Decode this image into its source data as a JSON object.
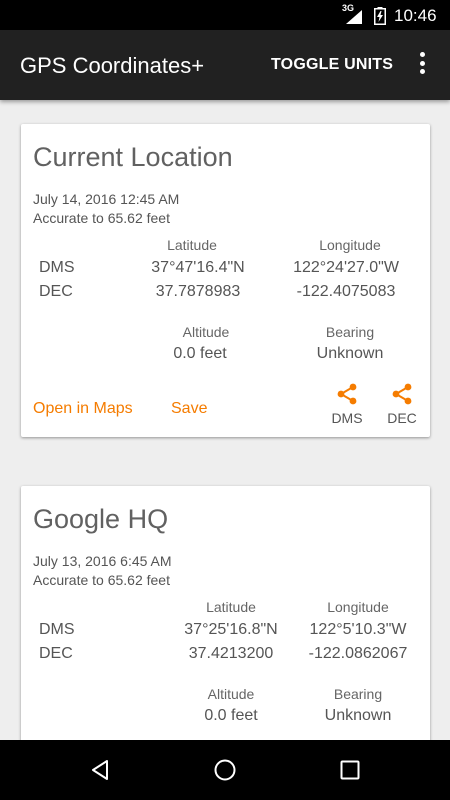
{
  "status_bar": {
    "network": "3G",
    "time": "10:46"
  },
  "app_bar": {
    "title": "GPS Coordinates+",
    "toggle_units": "TOGGLE UNITS",
    "overflow_icon": "more-vert-icon"
  },
  "cards": [
    {
      "title": "Current Location",
      "date": "July 14, 2016 12:45 AM",
      "accuracy": "Accurate to 65.62 feet",
      "latitude_header": "Latitude",
      "longitude_header": "Longitude",
      "dms_label": "DMS",
      "dec_label": "DEC",
      "dms_latitude": "37°47'16.4\"N",
      "dms_longitude": "122°24'27.0\"W",
      "dec_latitude": "37.7878983",
      "dec_longitude": "-122.4075083",
      "altitude_header": "Altitude",
      "altitude": "0.0 feet",
      "bearing_header": "Bearing",
      "bearing": "Unknown",
      "open_in_maps": "Open in Maps",
      "save": "Save",
      "share_dms": "DMS",
      "share_dec": "DEC"
    },
    {
      "title": "Google HQ",
      "date": "July 13, 2016 6:45 AM",
      "accuracy": "Accurate to 65.62 feet",
      "latitude_header": "Latitude",
      "longitude_header": "Longitude",
      "dms_label": "DMS",
      "dec_label": "DEC",
      "dms_latitude": "37°25'16.8\"N",
      "dms_longitude": "122°5'10.3\"W",
      "dec_latitude": "37.4213200",
      "dec_longitude": "-122.0862067",
      "altitude_header": "Altitude",
      "altitude": "0.0 feet",
      "bearing_header": "Bearing",
      "bearing": "Unknown"
    }
  ],
  "colors": {
    "accent": "#f57c00",
    "app_bar": "#212121",
    "background": "#eeeeee"
  }
}
